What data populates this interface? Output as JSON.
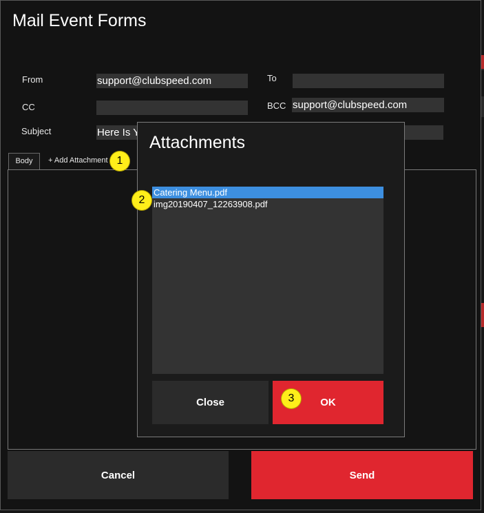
{
  "window": {
    "title": "Mail Event Forms"
  },
  "form": {
    "from_label": "From",
    "from_value": "support@clubspeed.com",
    "to_label": "To",
    "to_value": "",
    "cc_label": "CC",
    "cc_value": "",
    "bcc_label": "BCC",
    "bcc_value": "support@clubspeed.com",
    "subject_label": "Subject",
    "subject_value": "Here Is Y"
  },
  "tabs": {
    "body_label": "Body",
    "add_attachment_label": "+ Add Attachment"
  },
  "footer": {
    "cancel_label": "Cancel",
    "send_label": "Send"
  },
  "dialog": {
    "title": "Attachments",
    "files": [
      {
        "name": "Catering Menu.pdf",
        "selected": true
      },
      {
        "name": "img20190407_12263908.pdf",
        "selected": false
      }
    ],
    "close_label": "Close",
    "ok_label": "OK"
  },
  "markers": [
    "1",
    "2",
    "3"
  ],
  "colors": {
    "accent_red": "#e0262f",
    "selection_blue": "#3d8fe0",
    "marker_yellow": "#ffee1a"
  }
}
